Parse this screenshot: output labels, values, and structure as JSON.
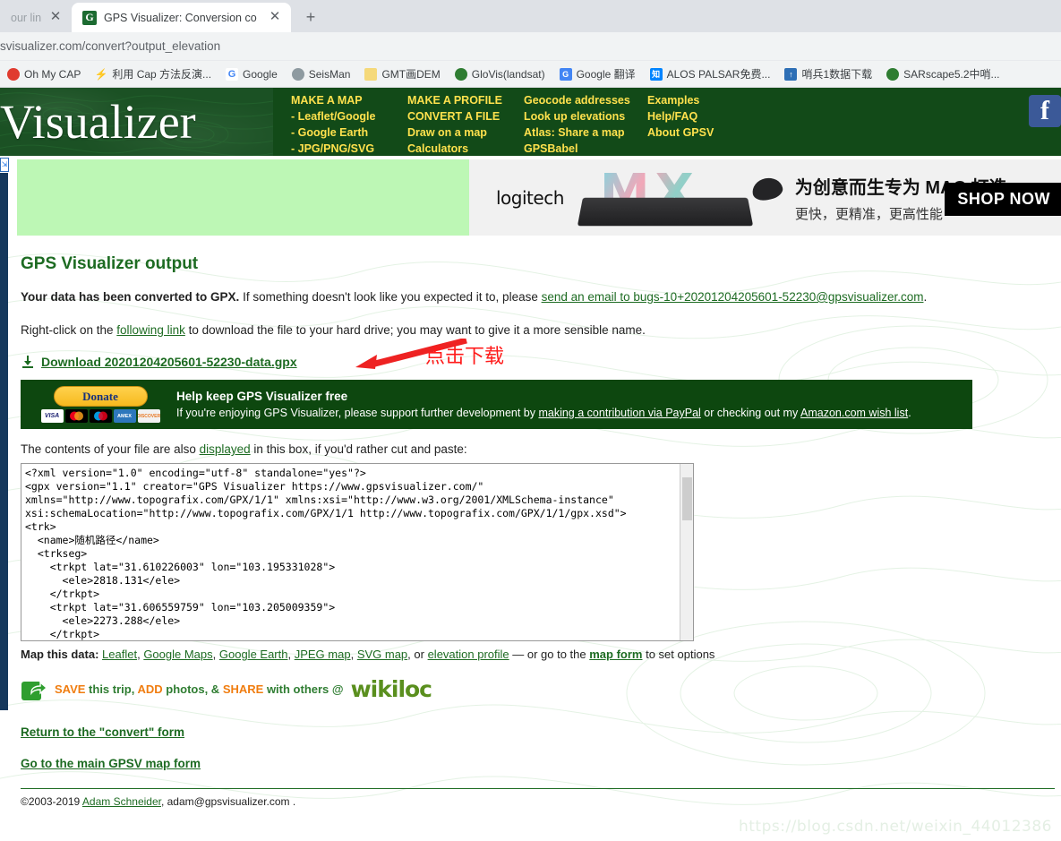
{
  "browser": {
    "tabs": [
      {
        "title": "our lines A",
        "favicon_label": "",
        "active": false
      },
      {
        "title": "GPS Visualizer: Conversion co",
        "favicon_label": "G",
        "active": true
      }
    ],
    "new_tab_label": "+",
    "close_label": "✕",
    "url": "svisualizer.com/convert?output_elevation",
    "bookmarks": [
      {
        "label": "Oh My CAP",
        "icon": "lifebuoy-icon",
        "color": "#e03b2f"
      },
      {
        "label": "利用 Cap 方法反演...",
        "icon": "bolt-icon",
        "color": "#e8383a"
      },
      {
        "label": "Google",
        "icon": "google-icon",
        "color": "#ffffff"
      },
      {
        "label": "SeisMan",
        "icon": "globe-gray-icon",
        "color": "#8e9aa0"
      },
      {
        "label": "GMT画DEM",
        "icon": "folder-icon",
        "color": "#f5d97a"
      },
      {
        "label": "GloVis(landsat)",
        "icon": "globe-icon",
        "color": "#2f7d32"
      },
      {
        "label": "Google 翻译",
        "icon": "translate-icon",
        "color": "#4285f4"
      },
      {
        "label": "ALOS PALSAR免费...",
        "icon": "zhihu-icon",
        "color": "#0084ff"
      },
      {
        "label": "哨兵1数据下载",
        "icon": "satellite-icon",
        "color": "#2e6fb5"
      },
      {
        "label": "SARscape5.2中哨...",
        "icon": "globe-icon",
        "color": "#2f7d32"
      }
    ]
  },
  "site_header": {
    "logo_text": "Visualizer",
    "nav_columns": [
      {
        "items": [
          "MAKE A MAP",
          "- Leaflet/Google",
          "- Google Earth",
          "- JPG/PNG/SVG"
        ]
      },
      {
        "items": [
          "MAKE A PROFILE",
          "CONVERT A FILE",
          "Draw on a map",
          "Calculators"
        ]
      },
      {
        "items": [
          "Geocode addresses",
          "Look up elevations",
          "Atlas: Share a map",
          "GPSBabel"
        ]
      },
      {
        "items": [
          "Examples",
          "Help/FAQ",
          "About GPSV"
        ]
      }
    ],
    "facebook_label": "f"
  },
  "ad": {
    "brand": "logitech",
    "headline_cn": "为创意而生专为 MAC 打造",
    "subline_cn": "更快，更精准，更高性能",
    "cta": "SHOP NOW",
    "product_letters": "MX"
  },
  "main": {
    "title": "GPS Visualizer output",
    "converted_bold": "Your data has been converted to GPX.",
    "converted_rest_1": " If something doesn't look like you expected it to, please ",
    "converted_link": "send an email to bugs-10+20201204205601-52230@gpsvisualizer.com",
    "converted_rest_2": ".",
    "rightclick_1": "Right-click on the ",
    "rightclick_link": "following link",
    "rightclick_2": " to download the file to your hard drive; you may want to give it a more sensible name.",
    "download_link": "Download 20201204205601-52230-data.gpx",
    "annotation_cn": "点击下载",
    "annotation_color": "#ff1a1a",
    "contents_1": "The contents of your file are also ",
    "contents_link": "displayed",
    "contents_2": " in this box, if you'd rather cut and paste:",
    "xml_content": "<?xml version=\"1.0\" encoding=\"utf-8\" standalone=\"yes\"?>\n<gpx version=\"1.1\" creator=\"GPS Visualizer https://www.gpsvisualizer.com/\"\nxmlns=\"http://www.topografix.com/GPX/1/1\" xmlns:xsi=\"http://www.w3.org/2001/XMLSchema-instance\"\nxsi:schemaLocation=\"http://www.topografix.com/GPX/1/1 http://www.topografix.com/GPX/1/1/gpx.xsd\">\n<trk>\n  <name>随机路径</name>\n  <trkseg>\n    <trkpt lat=\"31.610226003\" lon=\"103.195331028\">\n      <ele>2818.131</ele>\n    </trkpt>\n    <trkpt lat=\"31.606559759\" lon=\"103.205009359\">\n      <ele>2273.288</ele>\n    </trkpt>",
    "map_this_label": "Map this data:",
    "map_links": [
      "Leaflet",
      "Google Maps",
      "Google Earth",
      "JPEG map",
      "SVG map"
    ],
    "map_or": ", or ",
    "map_elev_link": "elevation profile",
    "map_tail_1": " — or go to the ",
    "map_form_link": "map form",
    "map_tail_2": " to set options",
    "wikiloc": {
      "save": "SAVE",
      "this_trip": " this trip, ",
      "add": "ADD",
      "photos": " photos, & ",
      "share": "SHARE",
      "with_others": " with others @",
      "logo": "wikiloc"
    },
    "bottom_links": [
      "Return to the \"convert\" form",
      "Go to the main GPSV map form"
    ],
    "footer_copy": "©2003-2019 ",
    "footer_link": "Adam Schneider",
    "footer_tail": ", adam@gpsvisualizer.com ."
  },
  "donate": {
    "button_label": "Donate",
    "heading": "Help keep GPS Visualizer free",
    "body_1": "If you're enjoying GPS Visualizer, please support further development by ",
    "link_1": "making a contribution via PayPal",
    "body_2": " or checking out my ",
    "link_2": "Amazon.com wish list",
    "body_3": ".",
    "cards": [
      "VISA",
      "MC",
      "MC2",
      "AMEX",
      "DISCOVER"
    ]
  },
  "watermark": "https://blog.csdn.net/weixin_44012386",
  "colors": {
    "header_green": "#124a18",
    "link_green": "#1d6b22",
    "donate_bg": "#0d470f",
    "ad_green": "#bdf7b5",
    "accent_yellow": "#ffe14d",
    "annotation_red": "#ff1a1a"
  }
}
